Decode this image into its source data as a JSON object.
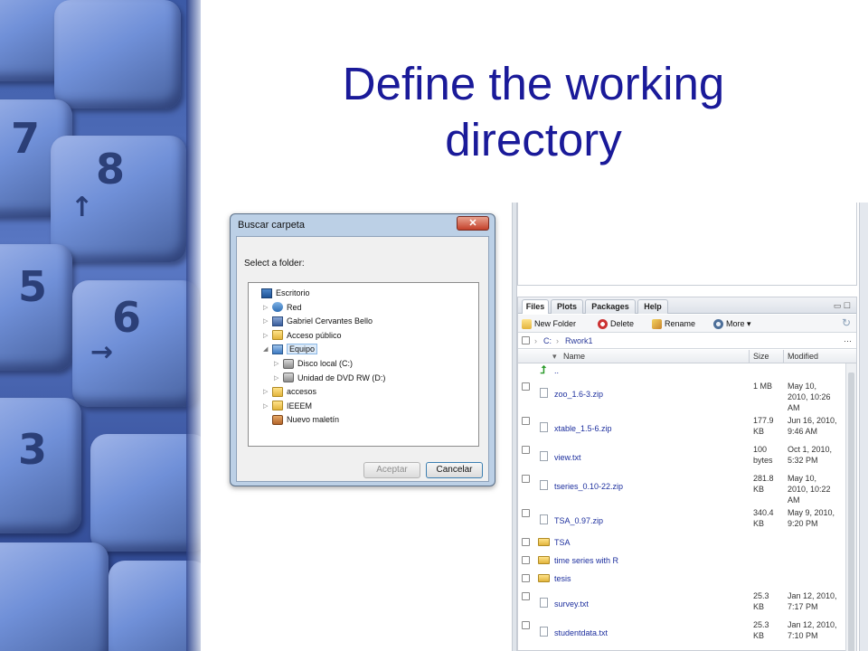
{
  "slide": {
    "title_line1": "Define the working",
    "title_line2": "directory"
  },
  "keys": [
    "7",
    "8",
    "5",
    "6",
    "3"
  ],
  "dialog": {
    "title": "Buscar carpeta",
    "close_glyph": "✕",
    "prompt": "Select a folder:",
    "tree": [
      {
        "label": "Escritorio",
        "icon": "desktop-icon",
        "level": 0,
        "toggle": ""
      },
      {
        "label": "Red",
        "icon": "network-icon",
        "level": 1,
        "toggle": "▷"
      },
      {
        "label": "Gabriel Cervantes Bello",
        "icon": "user-icon",
        "level": 1,
        "toggle": "▷"
      },
      {
        "label": "Acceso público",
        "icon": "folder-icon",
        "level": 1,
        "toggle": "▷"
      },
      {
        "label": "Equipo",
        "icon": "computer-icon",
        "level": 1,
        "toggle": "◢",
        "selected": true
      },
      {
        "label": "Disco local (C:)",
        "icon": "disk-icon",
        "level": 2,
        "toggle": "▷"
      },
      {
        "label": "Unidad de DVD RW (D:)",
        "icon": "dvd-icon",
        "level": 2,
        "toggle": "▷"
      },
      {
        "label": "accesos",
        "icon": "folder-icon",
        "level": 1,
        "toggle": "▷"
      },
      {
        "label": "IEEEM",
        "icon": "folder-icon",
        "level": 1,
        "toggle": "▷"
      },
      {
        "label": "Nuevo maletín",
        "icon": "briefcase-icon",
        "level": 1,
        "toggle": ""
      }
    ],
    "ok_label": "Aceptar",
    "cancel_label": "Cancelar"
  },
  "rstudio": {
    "tabs": [
      "Files",
      "Plots",
      "Packages",
      "Help"
    ],
    "active_tab": "Files",
    "toolbar": {
      "new_folder": "New Folder",
      "delete": "Delete",
      "rename": "Rename",
      "more": "More ▾"
    },
    "path": {
      "drive": "C:",
      "folder": "Rwork1",
      "sep": "›",
      "more": "···"
    },
    "columns": {
      "name": "Name",
      "size": "Size",
      "modified": "Modified",
      "sort_glyph": "▾"
    },
    "parent_label": "..",
    "files": [
      {
        "name": "zoo_1.6-3.zip",
        "type": "file",
        "size": [
          "1 MB"
        ],
        "modified": [
          "May 10,",
          "2010, 10:26",
          "AM"
        ]
      },
      {
        "name": "xtable_1.5-6.zip",
        "type": "file",
        "size": [
          "177.9",
          "KB"
        ],
        "modified": [
          "Jun 16, 2010,",
          "9:46 AM"
        ]
      },
      {
        "name": "view.txt",
        "type": "file",
        "size": [
          "100",
          "bytes"
        ],
        "modified": [
          "Oct 1, 2010,",
          "5:32 PM"
        ]
      },
      {
        "name": "tseries_0.10-22.zip",
        "type": "file",
        "size": [
          "281.8",
          "KB"
        ],
        "modified": [
          "May 10,",
          "2010, 10:22",
          "AM"
        ]
      },
      {
        "name": "TSA_0.97.zip",
        "type": "file",
        "size": [
          "340.4",
          "KB"
        ],
        "modified": [
          "May 9, 2010,",
          "9:20 PM"
        ]
      },
      {
        "name": "TSA",
        "type": "folder",
        "size": [],
        "modified": []
      },
      {
        "name": "time series with R",
        "type": "folder",
        "size": [],
        "modified": []
      },
      {
        "name": "tesis",
        "type": "folder",
        "size": [],
        "modified": []
      },
      {
        "name": "survey.txt",
        "type": "file",
        "size": [
          "25.3",
          "KB"
        ],
        "modified": [
          "Jan 12, 2010,",
          "7:17 PM"
        ]
      },
      {
        "name": "studentdata.txt",
        "type": "file",
        "size": [
          "25.3",
          "KB"
        ],
        "modified": [
          "Jan 12, 2010,",
          "7:10 PM"
        ]
      }
    ]
  },
  "colors": {
    "title": "#1a1a99",
    "link": "#1d2f9e",
    "accent": "#3c5aa6"
  }
}
